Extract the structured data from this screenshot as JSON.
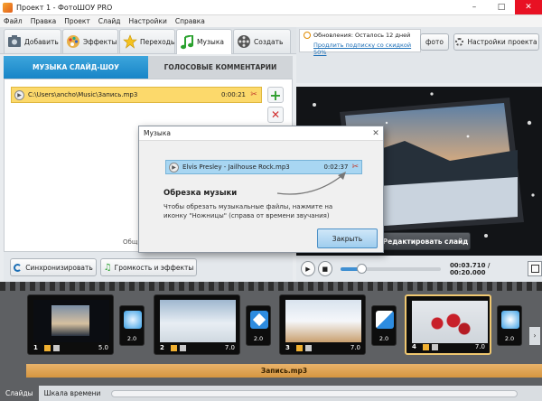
{
  "titlebar": {
    "title": "Проект 1 - ФотоШОУ PRO",
    "minimize": "–",
    "maximize": "□",
    "close": "✕"
  },
  "menu": [
    "Файл",
    "Правка",
    "Проект",
    "Слайд",
    "Настройки",
    "Справка"
  ],
  "tabs": [
    {
      "label": "Добавить",
      "icon": "add-photo-icon"
    },
    {
      "label": "Эффекты",
      "icon": "palette-icon"
    },
    {
      "label": "Переходы",
      "icon": "star-icon"
    },
    {
      "label": "Музыка",
      "icon": "music-note-icon",
      "active": true
    },
    {
      "label": "Создать",
      "icon": "film-reel-icon"
    }
  ],
  "update_notice": {
    "line1": "Обновления: Осталось 12 дней",
    "line2": "Продлить подписку со скидкой 50%"
  },
  "project_buttons": {
    "photo": "фото",
    "settings": "Настройки проекта"
  },
  "music_panel": {
    "tab_slideshow": "МУЗЫКА СЛАЙД-ШОУ",
    "tab_voice": "ГОЛОСОВЫЕ КОММЕНТАРИИ",
    "track": {
      "path": "C:\\Users\\ancho\\Music\\Запись.mp3",
      "duration": "0:00:21"
    },
    "fragment1": "О",
    "fragment2": "Общ",
    "sync_button": "Синхронизировать",
    "volume_button": "Громкость и эффекты"
  },
  "preview": {
    "edit_slide_button": "Редактировать слайд",
    "time": "00:03.710 / 00:20.000"
  },
  "dialog": {
    "title": "Музыка",
    "track": "Elvis Presley - Jailhouse Rock.mp3",
    "duration": "0:02:37",
    "heading": "Обрезка музыки",
    "text": "Чтобы обрезать музыкальные файлы, нажмите на иконку \"Ножницы\" (справа от времени звучания)",
    "ok": "Закрыть"
  },
  "timeline": {
    "slides": [
      {
        "number": "1",
        "duration": "5.0"
      },
      {
        "number": "2",
        "duration": "7.0"
      },
      {
        "number": "3",
        "duration": "7.0"
      },
      {
        "number": "4",
        "duration": "7.0"
      }
    ],
    "transitions": [
      "2.0",
      "2.0",
      "2.0",
      "2.0"
    ],
    "music_clip": "Запись.mp3"
  },
  "bottom_tabs": [
    "Слайды",
    "Шкала времени"
  ],
  "colors": {
    "accent": "#1785c7",
    "selection": "#efc770",
    "music_clip": "#e0a552",
    "track_highlight": "#fcd96b"
  }
}
